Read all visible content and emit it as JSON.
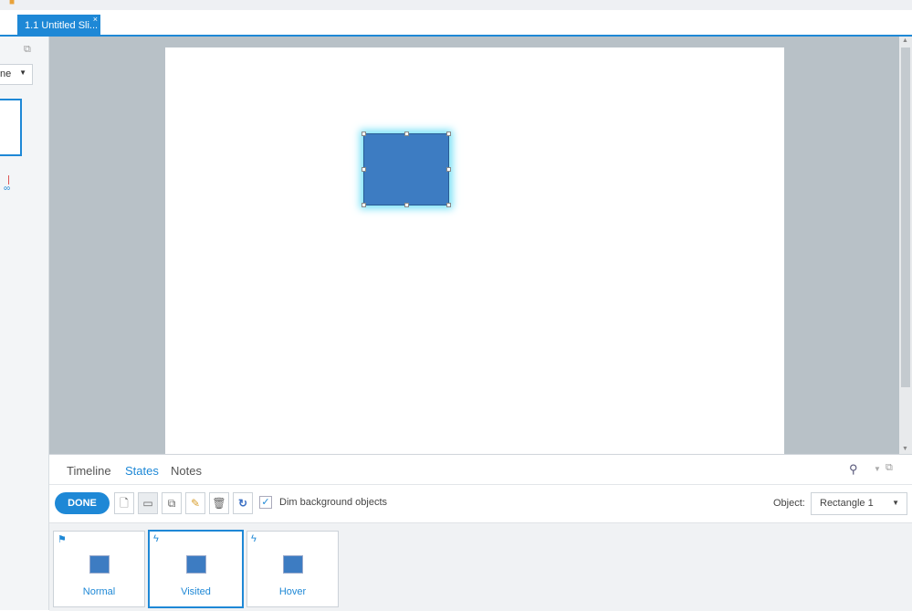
{
  "document_tab": {
    "title": "1.1 Untitled Sli...",
    "close": "×"
  },
  "left_panel": {
    "dropdown_partial": "ne"
  },
  "bottom_tabs": [
    {
      "label": "Timeline"
    },
    {
      "label": "States"
    },
    {
      "label": "Notes"
    }
  ],
  "toolbar": {
    "done": "DONE",
    "dim_label": "Dim background objects",
    "dim_checked": true,
    "object_label": "Object:",
    "object_value": "Rectangle 1"
  },
  "states": [
    {
      "label": "Normal",
      "icon": "flag-icon"
    },
    {
      "label": "Visited",
      "icon": "lightning-icon",
      "selected": true
    },
    {
      "label": "Hover",
      "icon": "lightning-icon"
    }
  ],
  "colors": {
    "accent": "#1e88d6",
    "shape": "#3d7cc2",
    "glow": "#7fe3f7"
  }
}
